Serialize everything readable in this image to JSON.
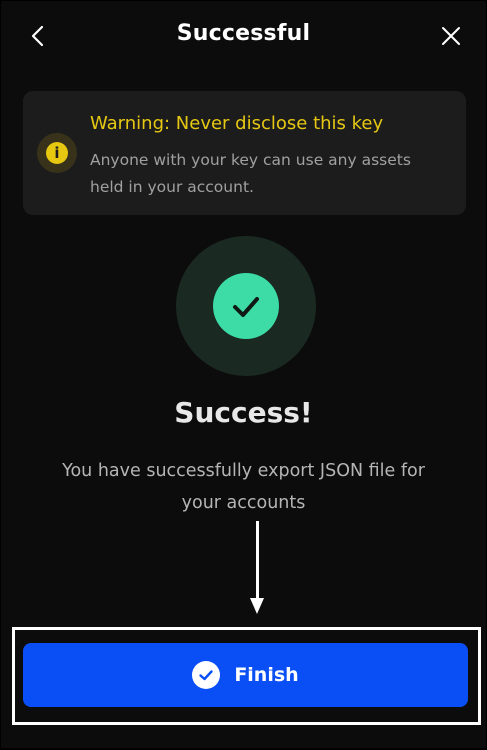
{
  "header": {
    "title": "Successful",
    "back_icon": "chevron-left-icon",
    "close_icon": "close-icon"
  },
  "warning": {
    "icon": "info-icon",
    "title": "Warning: Never disclose this key",
    "text": "Anyone with your key can use any assets held in your account.",
    "title_color": "#e6c813"
  },
  "success": {
    "icon": "check-icon",
    "heading": "Success!",
    "message": "You have successfully export JSON file for your accounts",
    "accent_color": "#3ddba6"
  },
  "finish_button": {
    "icon": "check-circle-icon",
    "label": "Finish",
    "color": "#0a4ff6"
  }
}
